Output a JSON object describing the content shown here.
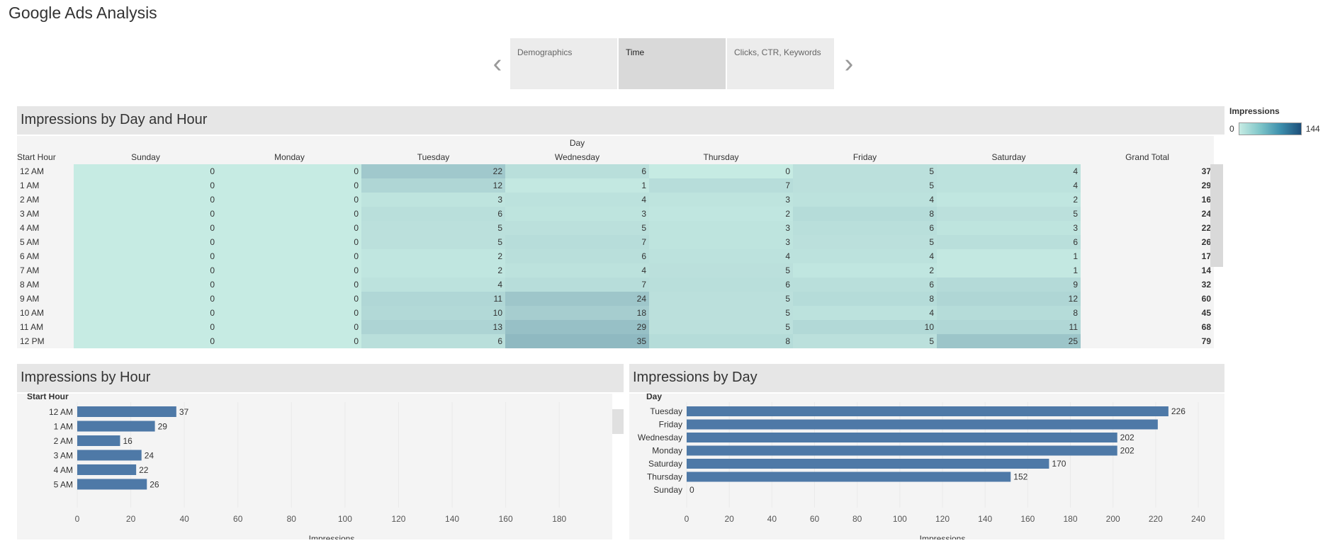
{
  "dashboard": {
    "title": "Google Ads Analysis"
  },
  "story": {
    "prev_icon": "chevron-left-icon",
    "next_icon": "chevron-right-icon",
    "tabs": [
      {
        "label": "Demographics",
        "active": false
      },
      {
        "label": "Time",
        "active": true
      },
      {
        "label": "Clicks, CTR, Keywords",
        "active": false
      }
    ]
  },
  "legend": {
    "title": "Impressions",
    "min": "0",
    "max": "144"
  },
  "colors": {
    "bar": "#4e79a7",
    "heat_low": "#c6ebe3",
    "heat_high": "#1d4f7a"
  },
  "chart_data": [
    {
      "type": "heatmap",
      "title": "Impressions by Day and Hour",
      "column_group_label": "Day",
      "row_label": "Start Hour",
      "columns": [
        "Sunday",
        "Monday",
        "Tuesday",
        "Wednesday",
        "Thursday",
        "Friday",
        "Saturday"
      ],
      "total_label": "Grand Total",
      "scale": [
        0,
        144
      ],
      "rows": [
        {
          "hour": "12 AM",
          "values": [
            0,
            0,
            22,
            6,
            0,
            5,
            4
          ],
          "total": 37
        },
        {
          "hour": "1 AM",
          "values": [
            0,
            0,
            12,
            1,
            7,
            5,
            4
          ],
          "total": 29
        },
        {
          "hour": "2 AM",
          "values": [
            0,
            0,
            3,
            4,
            3,
            4,
            2
          ],
          "total": 16
        },
        {
          "hour": "3 AM",
          "values": [
            0,
            0,
            6,
            3,
            2,
            8,
            5
          ],
          "total": 24
        },
        {
          "hour": "4 AM",
          "values": [
            0,
            0,
            5,
            5,
            3,
            6,
            3
          ],
          "total": 22
        },
        {
          "hour": "5 AM",
          "values": [
            0,
            0,
            5,
            7,
            3,
            5,
            6
          ],
          "total": 26
        },
        {
          "hour": "6 AM",
          "values": [
            0,
            0,
            2,
            6,
            4,
            4,
            1
          ],
          "total": 17
        },
        {
          "hour": "7 AM",
          "values": [
            0,
            0,
            2,
            4,
            5,
            2,
            1
          ],
          "total": 14
        },
        {
          "hour": "8 AM",
          "values": [
            0,
            0,
            4,
            7,
            6,
            6,
            9
          ],
          "total": 32
        },
        {
          "hour": "9 AM",
          "values": [
            0,
            0,
            11,
            24,
            5,
            8,
            12
          ],
          "total": 60
        },
        {
          "hour": "10 AM",
          "values": [
            0,
            0,
            10,
            18,
            5,
            4,
            8
          ],
          "total": 45
        },
        {
          "hour": "11 AM",
          "values": [
            0,
            0,
            13,
            29,
            5,
            10,
            11
          ],
          "total": 68
        },
        {
          "hour": "12 PM",
          "values": [
            0,
            0,
            6,
            35,
            8,
            5,
            25
          ],
          "total": 79
        }
      ]
    },
    {
      "type": "bar",
      "title": "Impressions by Hour",
      "ylabel": "Start Hour",
      "xlabel": "Impressions",
      "categories": [
        "12 AM",
        "1 AM",
        "2 AM",
        "3 AM",
        "4 AM",
        "5 AM"
      ],
      "values": [
        37,
        29,
        16,
        24,
        22,
        26
      ],
      "xlim": [
        0,
        190
      ],
      "ticks": [
        "0",
        "20",
        "40",
        "60",
        "80",
        "100",
        "120",
        "140",
        "160",
        "180"
      ]
    },
    {
      "type": "bar",
      "title": "Impressions by Day",
      "ylabel": "Day",
      "xlabel": "Impressions",
      "sort_icon": "sort-descending-icon",
      "categories": [
        "Tuesday",
        "Friday",
        "Wednesday",
        "Monday",
        "Saturday",
        "Thursday",
        "Sunday"
      ],
      "values": [
        226,
        221,
        202,
        202,
        170,
        152,
        0
      ],
      "labels": [
        "226",
        "",
        "202",
        "202",
        "170",
        "152",
        "0"
      ],
      "xlim": [
        0,
        240
      ],
      "ticks": [
        "0",
        "20",
        "40",
        "60",
        "80",
        "100",
        "120",
        "140",
        "160",
        "180",
        "200",
        "220",
        "240"
      ]
    }
  ]
}
